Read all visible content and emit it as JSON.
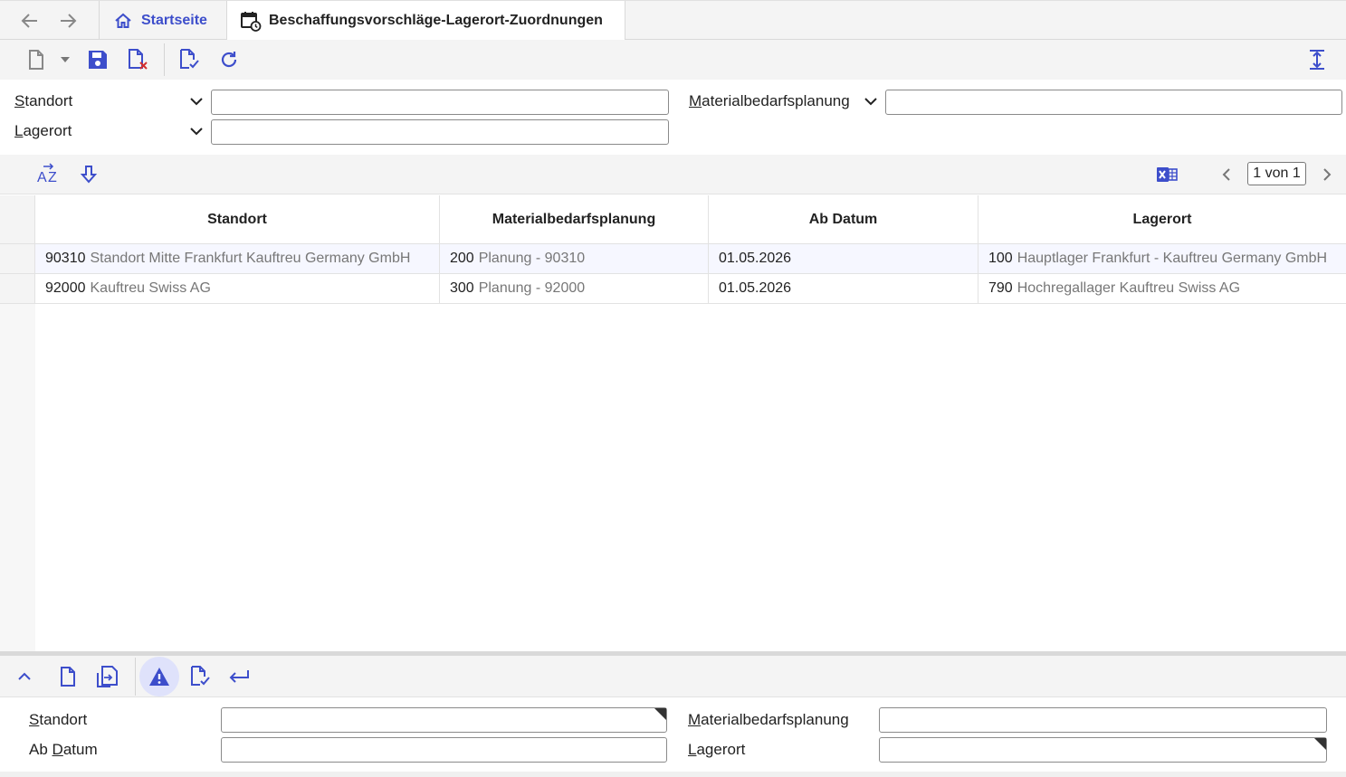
{
  "tabs": {
    "home_label": "Startseite",
    "active_label": "Beschaffungsvorschläge-Lagerort-Zuordnungen"
  },
  "filter": {
    "standort_label_first": "S",
    "standort_label_rest": "tandort",
    "lagerort_label_first": "L",
    "lagerort_label_rest": "agerort",
    "mat_label_first": "M",
    "mat_label_rest": "aterialbedarfsplanung",
    "standort_value": "",
    "lagerort_value": "",
    "mat_value": ""
  },
  "grid": {
    "pager": "1 von 1",
    "columns": [
      "Standort",
      "Materialbedarfsplanung",
      "Ab Datum",
      "Lagerort"
    ],
    "rows": [
      {
        "standort_code": "90310",
        "standort_desc": "Standort Mitte Frankfurt Kauftreu Germany GmbH",
        "mat_code": "200",
        "mat_desc": "Planung - 90310",
        "date": "01.05.2026",
        "lager_code": "100",
        "lager_desc": "Hauptlager Frankfurt -  Kauftreu Germany GmbH"
      },
      {
        "standort_code": "92000",
        "standort_desc": "Kauftreu Swiss AG",
        "mat_code": "300",
        "mat_desc": "Planung - 92000",
        "date": "01.05.2026",
        "lager_code": "790",
        "lager_desc": "Hochregallager Kauftreu Swiss AG"
      }
    ]
  },
  "detail": {
    "standort_first": "S",
    "standort_rest": "tandort",
    "abdatum_pre": "Ab ",
    "abdatum_first": "D",
    "abdatum_rest": "atum",
    "mat_first": "M",
    "mat_rest": "aterialbedarfsplanung",
    "lagerort_first": "L",
    "lagerort_rest": "agerort"
  },
  "colors": {
    "accent": "#3d4ecb",
    "danger": "#d32f2f",
    "excel": "#3d4ecb"
  },
  "icons": [
    "arrow-left-icon",
    "arrow-right-icon",
    "home-icon",
    "calendar-clock-icon",
    "new-document-icon",
    "dropdown-caret-icon",
    "save-icon",
    "delete-document-icon",
    "validate-document-icon",
    "refresh-icon",
    "expand-vertical-icon",
    "sort-az-icon",
    "sort-down-icon",
    "excel-icon",
    "prev-page-icon",
    "next-page-icon",
    "collapse-icon",
    "copy-icon",
    "warning-icon",
    "return-icon"
  ]
}
